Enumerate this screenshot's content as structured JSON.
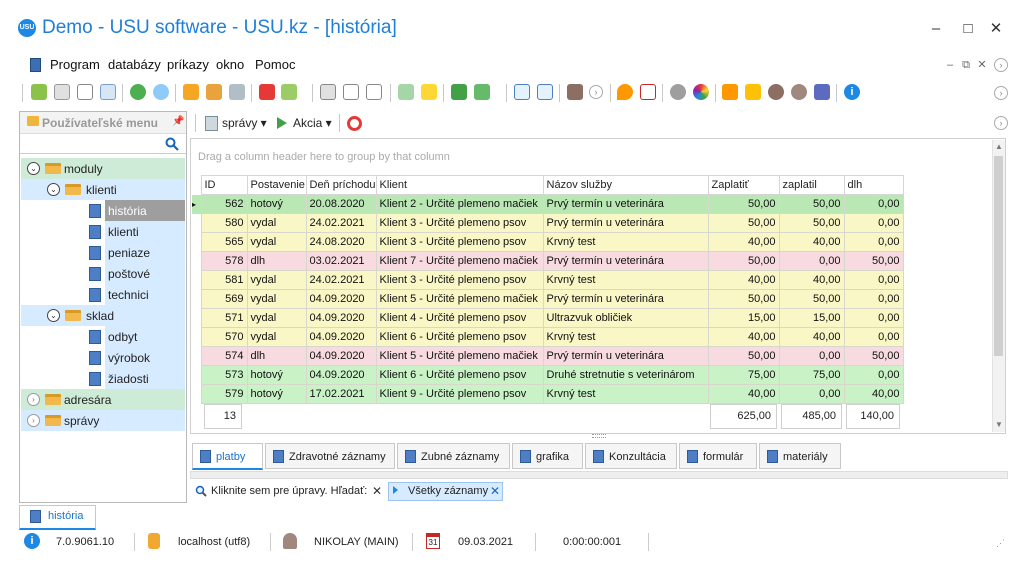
{
  "window": {
    "logo_text": "USU",
    "title": "Demo - USU software - USU.kz - [história]",
    "minimize": "–",
    "maximize": "□",
    "close": "✕"
  },
  "menu": {
    "items": [
      "Program",
      "databázy",
      "príkazy",
      "okno",
      "Pomoc"
    ],
    "mdi_minimize": "–",
    "mdi_restore": "⧉",
    "mdi_close": "✕"
  },
  "left_panel": {
    "title": "Používateľské menu",
    "pin": "ᵖ",
    "tree": [
      {
        "label": "moduly",
        "expander": "⌄"
      },
      {
        "label": "klienti",
        "expander": "⌄"
      },
      {
        "label": "história"
      },
      {
        "label": "klienti"
      },
      {
        "label": "peniaze"
      },
      {
        "label": "poštové"
      },
      {
        "label": "technici"
      },
      {
        "label": "sklad",
        "expander": "⌄"
      },
      {
        "label": "odbyt"
      },
      {
        "label": "výrobok"
      },
      {
        "label": "žiadosti"
      },
      {
        "label": "adresára",
        "expander": "›"
      },
      {
        "label": "správy",
        "expander": "›"
      }
    ]
  },
  "sub_toolbar": {
    "reports_label": "správy",
    "action_label": "Akcia"
  },
  "grid": {
    "group_hint": "Drag a column header here to group by that column",
    "columns": [
      "ID",
      "Postavenie",
      "Deň príchodu",
      "Klient",
      "Názov služby",
      "Zaplatiť",
      "zaplatil",
      "dlh"
    ],
    "rows": [
      [
        "562",
        "hotový",
        "20.08.2020",
        "Klient 2 - Určité plemeno mačiek",
        "Prvý termín u veterinára",
        "50,00",
        "50,00",
        "0,00"
      ],
      [
        "580",
        "vydal",
        "24.02.2021",
        "Klient 3 - Určité plemeno psov",
        "Prvý termín u veterinára",
        "50,00",
        "50,00",
        "0,00"
      ],
      [
        "565",
        "vydal",
        "24.08.2020",
        "Klient 3 - Určité plemeno psov",
        "Krvný test",
        "40,00",
        "40,00",
        "0,00"
      ],
      [
        "578",
        "dlh",
        "03.02.2021",
        "Klient 7 - Určité plemeno mačiek",
        "Prvý termín u veterinára",
        "50,00",
        "0,00",
        "50,00"
      ],
      [
        "581",
        "vydal",
        "24.02.2021",
        "Klient 3 - Určité plemeno psov",
        "Krvný test",
        "40,00",
        "40,00",
        "0,00"
      ],
      [
        "569",
        "vydal",
        "04.09.2020",
        "Klient 5 - Určité plemeno mačiek",
        "Prvý termín u veterinára",
        "50,00",
        "50,00",
        "0,00"
      ],
      [
        "571",
        "vydal",
        "04.09.2020",
        "Klient 4 - Určité plemeno psov",
        "Ultrazvuk obličiek",
        "15,00",
        "15,00",
        "0,00"
      ],
      [
        "570",
        "vydal",
        "04.09.2020",
        "Klient 6 - Určité plemeno psov",
        "Krvný test",
        "40,00",
        "40,00",
        "0,00"
      ],
      [
        "574",
        "dlh",
        "04.09.2020",
        "Klient 5 - Určité plemeno mačiek",
        "Prvý termín u veterinára",
        "50,00",
        "0,00",
        "50,00"
      ],
      [
        "573",
        "hotový",
        "04.09.2020",
        "Klient 6 - Určité plemeno psov",
        "Druhé stretnutie s veterinárom",
        "75,00",
        "75,00",
        "0,00"
      ],
      [
        "579",
        "hotový",
        "17.02.2021",
        "Klient 9 - Určité plemeno psov",
        "Krvný test",
        "40,00",
        "0,00",
        "40,00"
      ]
    ],
    "row_colors": [
      "green",
      "yellow",
      "yellow",
      "pink",
      "yellow",
      "yellow",
      "yellow",
      "yellow",
      "pink",
      "green",
      "green"
    ],
    "footer": {
      "count": "13",
      "to_pay": "625,00",
      "paid": "485,00",
      "debt": "140,00"
    }
  },
  "tabs": [
    "platby",
    "Zdravotné záznamy",
    "Zubné záznamy",
    "grafika",
    "Konzultácia",
    "formulár",
    "materiály"
  ],
  "filter": {
    "edit_hint": "Kliknite sem pre úpravy. Hľadať:",
    "all_records": "Všetky záznamy",
    "close": "✕"
  },
  "doc_tab": {
    "label": "história"
  },
  "status": {
    "version": "7.0.9061.10",
    "server": "localhost (utf8)",
    "user": "NIKOLAY (MAIN)",
    "date": "09.03.2021",
    "timer": "0:00:00:001",
    "calendar_day": "31"
  },
  "colors": {
    "accent": "#1e88e5",
    "row_green": "#c9f2c7",
    "row_yellow": "#f9f7c6",
    "row_pink": "#f8dbe0"
  }
}
